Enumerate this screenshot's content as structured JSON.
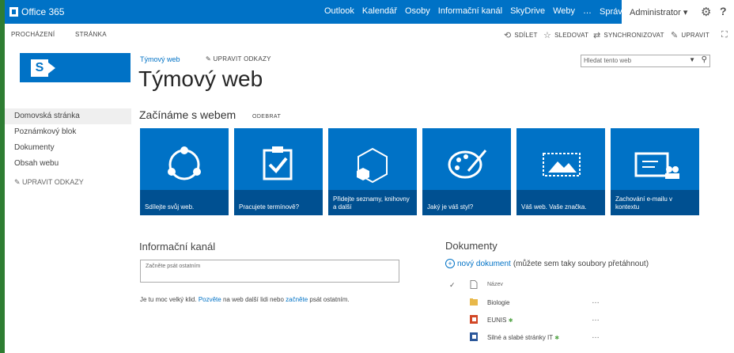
{
  "suite": {
    "brand": "Office 365",
    "nav": [
      "Outlook",
      "Kalendář",
      "Osoby",
      "Informační kanál",
      "SkyDrive",
      "Weby",
      "…",
      "Správce ▾"
    ],
    "user": "Administrator ▾",
    "settings_icon": "gear-icon",
    "help": "?"
  },
  "ribbon": {
    "tabs": [
      "PROCHÁZENÍ",
      "STRÁNKA"
    ],
    "actions": [
      {
        "label": "SDÍLET",
        "icon": "share-icon"
      },
      {
        "label": "SLEDOVAT",
        "icon": "star-icon"
      },
      {
        "label": "SYNCHRONIZOVAT",
        "icon": "sync-icon"
      },
      {
        "label": "UPRAVIT",
        "icon": "pencil-icon"
      }
    ]
  },
  "leftnav": {
    "items": [
      "Domovská stránka",
      "Poznámkový blok",
      "Dokumenty",
      "Obsah webu"
    ],
    "edit_links": "UPRAVIT ODKAZY"
  },
  "header": {
    "breadcrumb": "Týmový web",
    "edit_links": "UPRAVIT ODKAZY",
    "title": "Týmový web",
    "search_placeholder": "Hledat tento web"
  },
  "getting_started": {
    "heading": "Začínáme s webem",
    "remove": "ODEBRAT",
    "tiles": [
      {
        "caption": "Sdílejte svůj web.",
        "icon": "share-circle-icon"
      },
      {
        "caption": "Pracujete termínově?",
        "icon": "clipboard-check-icon"
      },
      {
        "caption": "Přidejte seznamy, knihovny a další",
        "icon": "hexagon-app-icon"
      },
      {
        "caption": "Jaký je váš styl?",
        "icon": "palette-icon"
      },
      {
        "caption": "Váš web. Vaše značka.",
        "icon": "picture-icon"
      },
      {
        "caption": "Zachování e-mailu v kontextu",
        "icon": "mail-people-icon"
      }
    ]
  },
  "newsfeed": {
    "heading": "Informační kanál",
    "placeholder": "Začněte psát ostatním",
    "text_a": "Je tu moc velký klid.",
    "link_a": "Pozvěte",
    "text_b": "na web další lidi nebo",
    "link_b": "začněte",
    "text_c": "psát ostatním."
  },
  "documents": {
    "heading": "Dokumenty",
    "new_link": "nový dokument",
    "new_hint": "(můžete sem taky soubory přetáhnout)",
    "column_name": "Název",
    "rows": [
      {
        "name": "Biologie",
        "type": "folder",
        "new": false
      },
      {
        "name": "EUNIS",
        "type": "powerpoint",
        "new": true
      },
      {
        "name": "Silné a slabé stránky IT",
        "type": "word",
        "new": true
      }
    ],
    "new_mark": "✱",
    "more": "…"
  },
  "colors": {
    "accent": "#0072c6",
    "tile": "#0072c6",
    "background_strip": "#2e7d32"
  }
}
